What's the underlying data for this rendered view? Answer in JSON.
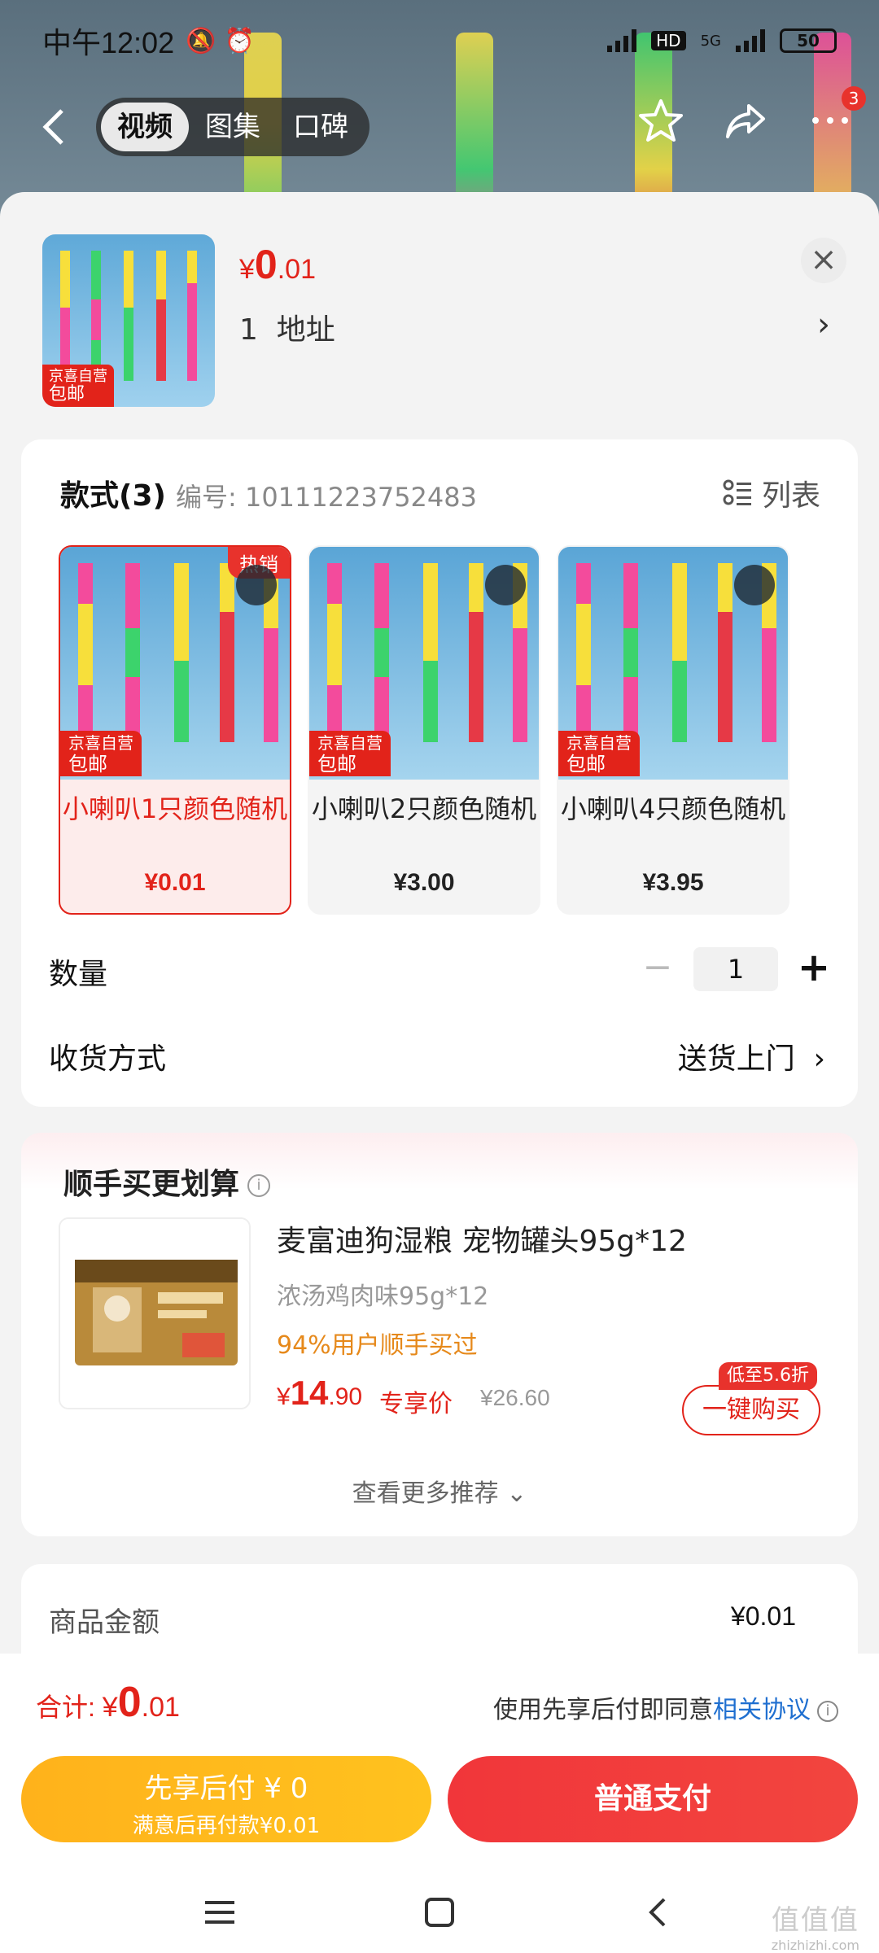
{
  "status_bar": {
    "time": "中午12:02",
    "battery": "50",
    "net": "5G",
    "hd": "HD"
  },
  "top_nav": {
    "tabs": [
      "视频",
      "图集",
      "口碑"
    ],
    "active_tab": 0,
    "cart_badge": "3"
  },
  "product": {
    "price_symbol": "¥",
    "price_int": "0",
    "price_dec": ".01",
    "address_count": "1",
    "address_label": "地址",
    "thumb_tag_top": "京喜自营",
    "thumb_tag_bottom": "包邮"
  },
  "styles": {
    "title": "款式(3)",
    "code_label": "编号: 10111223752483",
    "list_label": "列表",
    "options": [
      {
        "name": "小喇叭1只颜色随机",
        "price": "¥0.01",
        "hot": "热销",
        "tag_top": "京喜自营",
        "tag_bottom": "包邮"
      },
      {
        "name": "小喇叭2只颜色随机",
        "price": "¥3.00",
        "tag_top": "京喜自营",
        "tag_bottom": "包邮"
      },
      {
        "name": "小喇叭4只颜色随机",
        "price": "¥3.95",
        "tag_top": "京喜自营",
        "tag_bottom": "包邮"
      }
    ]
  },
  "quantity": {
    "label": "数量",
    "value": "1",
    "minus": "−",
    "plus": "+"
  },
  "shipping": {
    "label": "收货方式",
    "value": "送货上门"
  },
  "recommend": {
    "title": "顺手买更划算",
    "info": "i",
    "name": "麦富迪狗湿粮 宠物罐头95g*12",
    "spec": "浓汤鸡肉味95g*12",
    "stat": "94%用户顺手买过",
    "price_symbol": "¥",
    "price_int": "14",
    "price_dec": ".90",
    "exclusive": "专享价",
    "orig_price": "¥26.60",
    "discount_tag": "低至5.6折",
    "buy_label": "一键购买",
    "more_label": "查看更多推荐 ⌄"
  },
  "amount": {
    "label": "商品金额",
    "value": "¥0.01"
  },
  "footer": {
    "total_label": "合计: ",
    "total_symbol": "¥",
    "total_int": "0",
    "total_dec": ".01",
    "agree_prefix": "使用先享后付即同意",
    "agree_link": "相关协议",
    "later_line1": "先享后付 ¥ 0",
    "later_line2": "满意后再付款¥0.01",
    "normal_label": "普通支付"
  },
  "watermark": {
    "line1": "值值值",
    "line2": "zhizhizhi.com"
  },
  "colors": {
    "accent": "#e2231a",
    "later_btn": "#ffb21b",
    "link": "#1f6fd0"
  }
}
